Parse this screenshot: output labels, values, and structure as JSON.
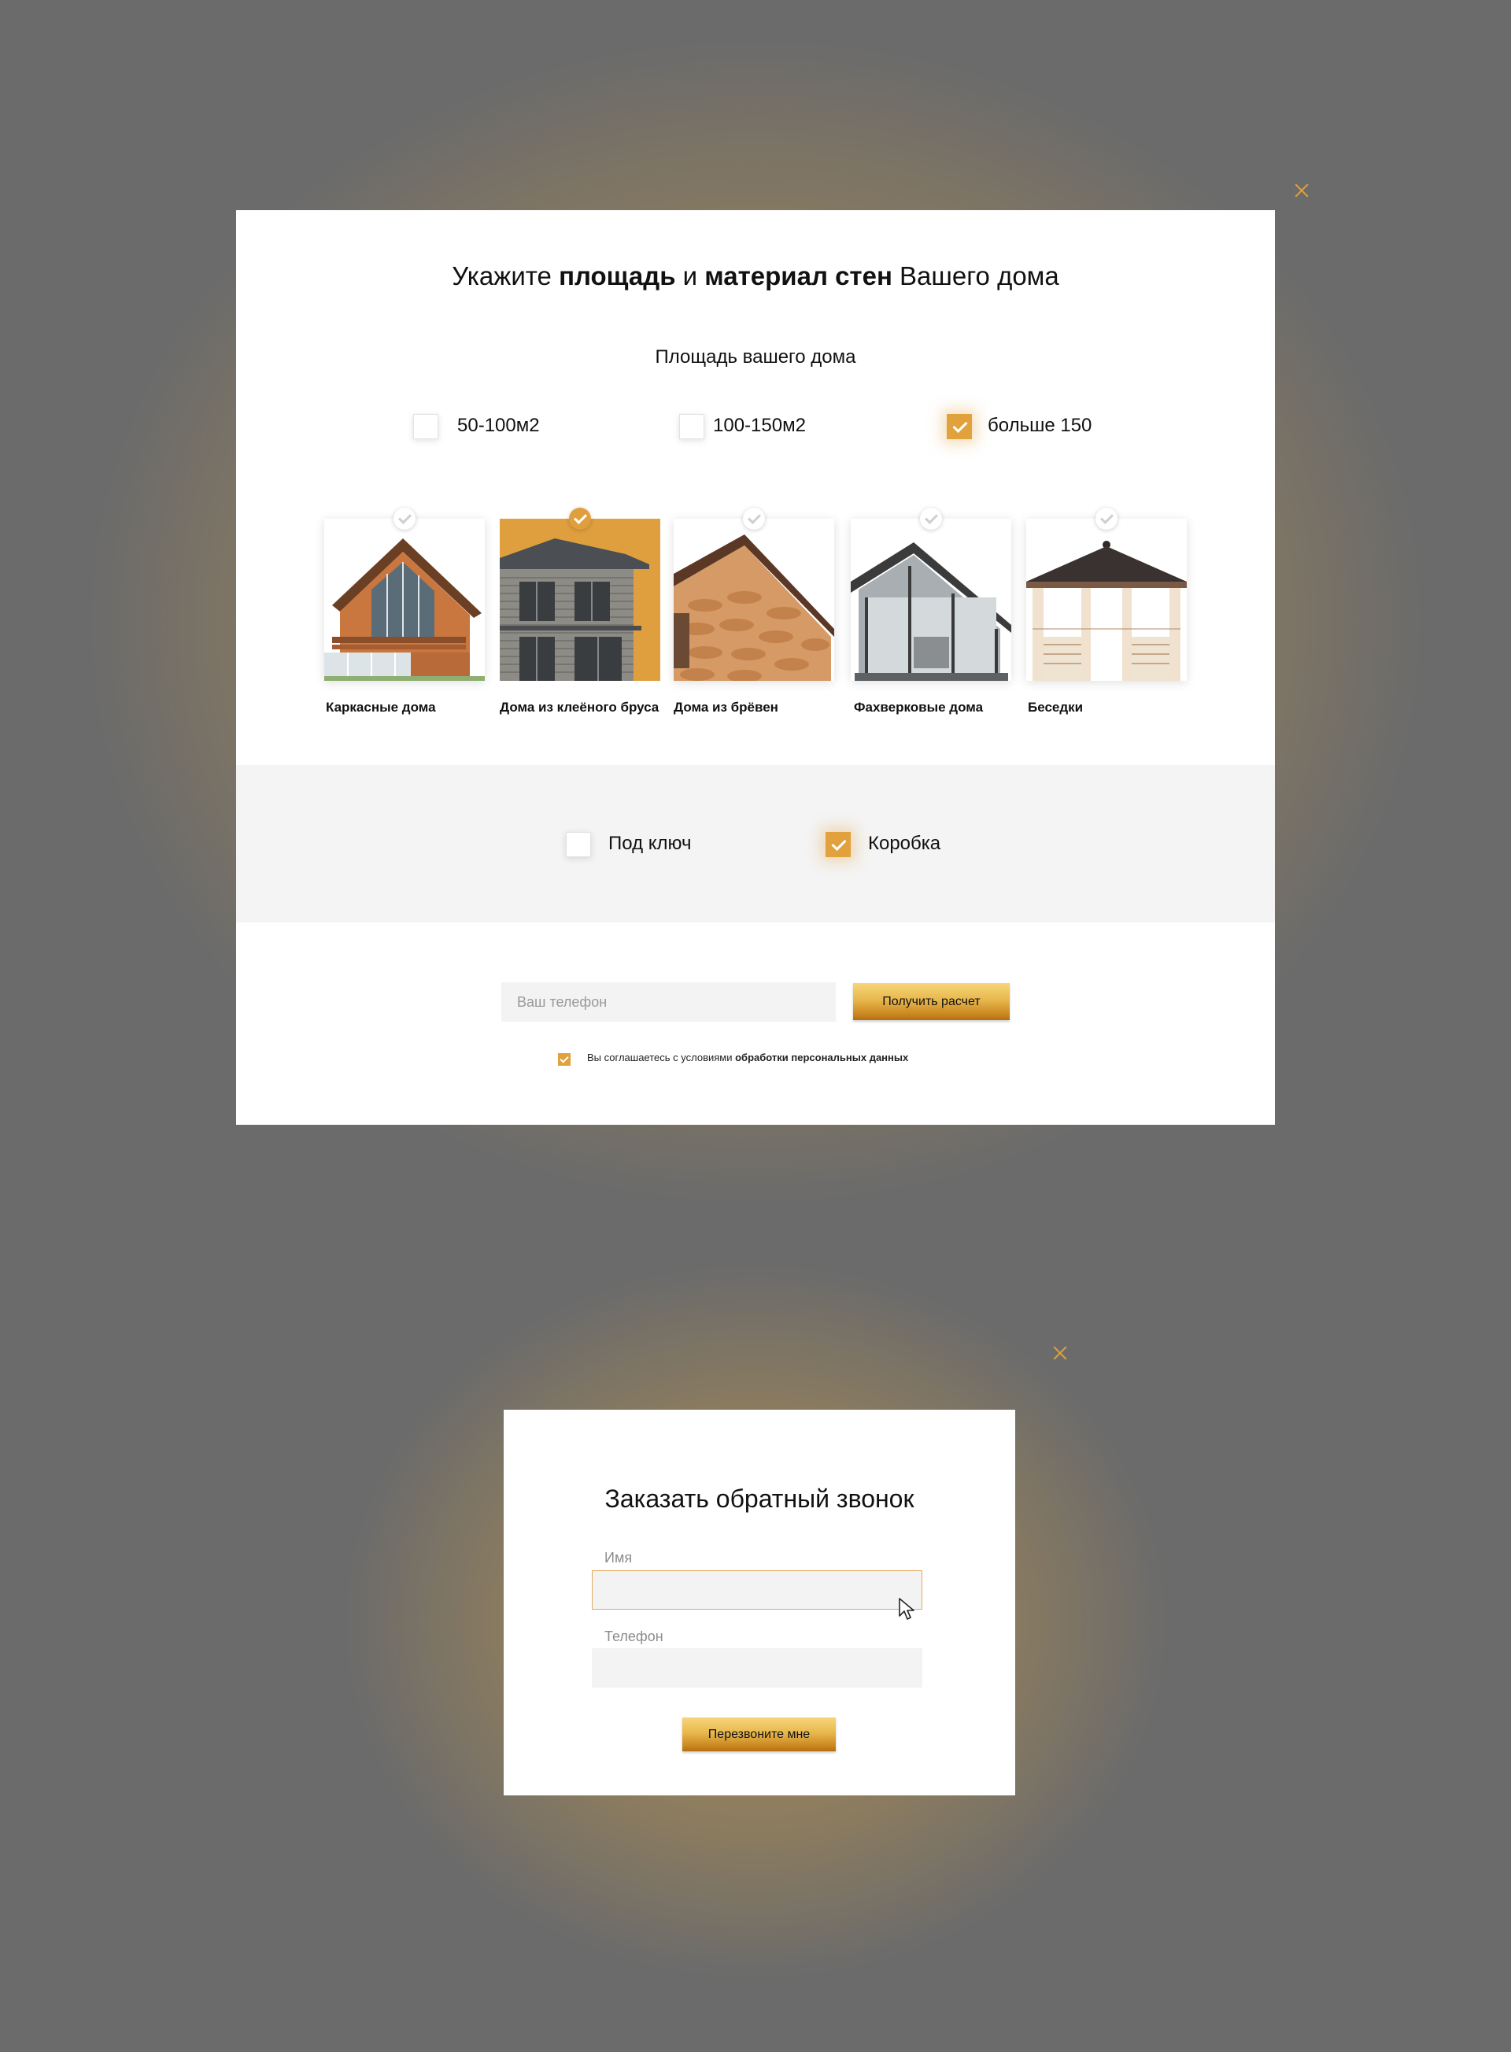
{
  "modal_area": {
    "title_parts": [
      "Укажите ",
      "площадь",
      " и ",
      "материал стен",
      " Вашего дома"
    ],
    "subtitle": "Площадь вашего дома",
    "area_options": [
      {
        "label": "50-100м2",
        "checked": false
      },
      {
        "label": "100-150м2",
        "checked": false
      },
      {
        "label": "больше 150",
        "checked": true
      }
    ],
    "house_types": [
      {
        "label": "Каркасные дома",
        "selected": false
      },
      {
        "label": "Дома из клеёного бруса",
        "selected": true
      },
      {
        "label": "Дома из брёвен",
        "selected": false
      },
      {
        "label": "Фахверковые дома",
        "selected": false
      },
      {
        "label": "Беседки",
        "selected": false
      }
    ],
    "package_options": [
      {
        "label": "Под ключ",
        "checked": false
      },
      {
        "label": "Коробка",
        "checked": true
      }
    ],
    "phone_placeholder": "Ваш телефон",
    "submit_label": "Получить расчет",
    "agree_text": "Вы соглашаетесь с условиями ",
    "agree_link": "обработки персональных данных",
    "agree_checked": true
  },
  "modal_callback": {
    "title": "Заказать обратный звонок",
    "name_label": "Имя",
    "phone_label": "Телефон",
    "submit_label": "Перезвоните мне"
  },
  "colors": {
    "accent": "#e1a13c",
    "backdrop": "#6b6b6b",
    "field_bg": "#f3f3f3"
  },
  "icons": [
    "close-icon",
    "check-icon",
    "mouse-pointer-icon"
  ]
}
